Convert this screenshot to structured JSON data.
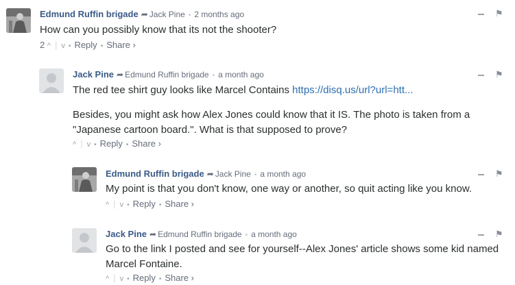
{
  "comments": [
    {
      "author": "Edmund Ruffin brigade",
      "parent": "Jack Pine",
      "time": "2 months ago",
      "body": [
        "How can you possibly know that its not the shooter?"
      ],
      "votes": "2",
      "reply": "Reply",
      "share": "Share ›",
      "avatar": "photo"
    },
    {
      "author": "Jack Pine",
      "parent": "Edmund Ruffin brigade",
      "time": "a month ago",
      "body_line1": "The red tee shirt guy looks like Marcel Contains ",
      "link": "https://disq.us/url?url=htt...",
      "body_para2": "Besides, you might ask how Alex Jones could know that it IS. The photo is taken from a \"Japanese cartoon board.\". What is that supposed to prove?",
      "reply": "Reply",
      "share": "Share ›",
      "avatar": "default"
    },
    {
      "author": "Edmund Ruffin brigade",
      "parent": "Jack Pine",
      "time": "a month ago",
      "body": [
        "My point is that you don't know, one way or another, so quit acting like you know."
      ],
      "reply": "Reply",
      "share": "Share ›",
      "avatar": "photo"
    },
    {
      "author": "Jack Pine",
      "parent": "Edmund Ruffin brigade",
      "time": "a month ago",
      "body": [
        "Go to the link I posted and see for yourself--Alex Jones' article shows some kid named Marcel Fontaine."
      ],
      "reply": "Reply",
      "share": "Share ›",
      "avatar": "default"
    }
  ],
  "icons": {
    "reply_arrow": "➦",
    "upvote": "^",
    "downvote": "v",
    "flag": "⚑"
  }
}
